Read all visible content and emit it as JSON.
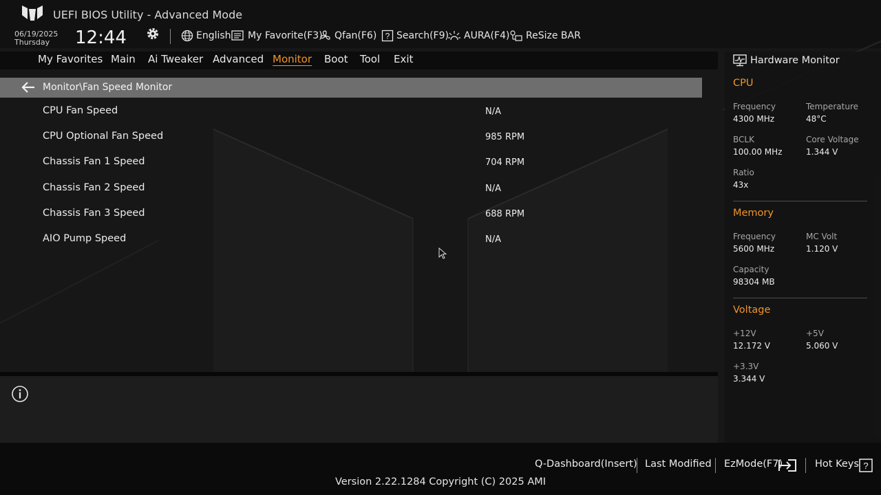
{
  "header": {
    "title": "UEFI BIOS Utility - Advanced Mode",
    "date": "06/19/2025",
    "day": "Thursday",
    "time": "12:44",
    "icons": {
      "logo": "tuf-logo-icon",
      "settings": "gear-icon"
    },
    "tools": [
      {
        "label": "English",
        "icon": "globe-icon"
      },
      {
        "label": "My Favorite(F3)",
        "icon": "favorite-list-icon"
      },
      {
        "label": "Qfan(F6)",
        "icon": "fan-icon"
      },
      {
        "label": "Search(F9)",
        "icon": "search-box-icon"
      },
      {
        "label": "AURA(F4)",
        "icon": "aura-light-icon"
      },
      {
        "label": "ReSize BAR",
        "icon": "resize-bar-icon"
      }
    ]
  },
  "menu": {
    "items": [
      "My Favorites",
      "Main",
      "Ai Tweaker",
      "Advanced",
      "Monitor",
      "Boot",
      "Tool",
      "Exit"
    ],
    "active": "Monitor"
  },
  "breadcrumb": {
    "text": "Monitor\\Fan Speed Monitor",
    "icon": "back-arrow-icon"
  },
  "rows": [
    {
      "label": "CPU Fan Speed",
      "value": "N/A"
    },
    {
      "label": "CPU Optional Fan Speed",
      "value": "985 RPM"
    },
    {
      "label": "Chassis Fan 1 Speed",
      "value": "704 RPM"
    },
    {
      "label": "Chassis Fan 2 Speed",
      "value": "N/A"
    },
    {
      "label": "Chassis Fan 3 Speed",
      "value": "688 RPM"
    },
    {
      "label": "AIO Pump Speed",
      "value": "N/A"
    }
  ],
  "info": {
    "icon": "info-icon"
  },
  "hardware_monitor": {
    "title": "Hardware Monitor",
    "icon": "monitor-chart-icon",
    "cpu": {
      "heading": "CPU",
      "frequency_label": "Frequency",
      "frequency": "4300 MHz",
      "temperature_label": "Temperature",
      "temperature": "48°C",
      "bclk_label": "BCLK",
      "bclk": "100.00 MHz",
      "core_voltage_label": "Core Voltage",
      "core_voltage": "1.344 V",
      "ratio_label": "Ratio",
      "ratio": "43x"
    },
    "memory": {
      "heading": "Memory",
      "frequency_label": "Frequency",
      "frequency": "5600 MHz",
      "mc_volt_label": "MC Volt",
      "mc_volt": "1.120 V",
      "capacity_label": "Capacity",
      "capacity": "98304 MB"
    },
    "voltage": {
      "heading": "Voltage",
      "v12_label": "+12V",
      "v12": "12.172 V",
      "v5_label": "+5V",
      "v5": "5.060 V",
      "v33_label": "+3.3V",
      "v33": "3.344 V"
    }
  },
  "footer": {
    "qdashboard": "Q-Dashboard(Insert)",
    "last_modified": "Last Modified",
    "ezmode": "EzMode(F7)",
    "hotkeys": "Hot Keys",
    "version": "Version 2.22.1284 Copyright (C) 2025 AMI"
  },
  "colors": {
    "accent": "#f0942a",
    "background": "#171717",
    "breadcrumb_bar": "#6e6e6e",
    "text": "#ececec"
  }
}
